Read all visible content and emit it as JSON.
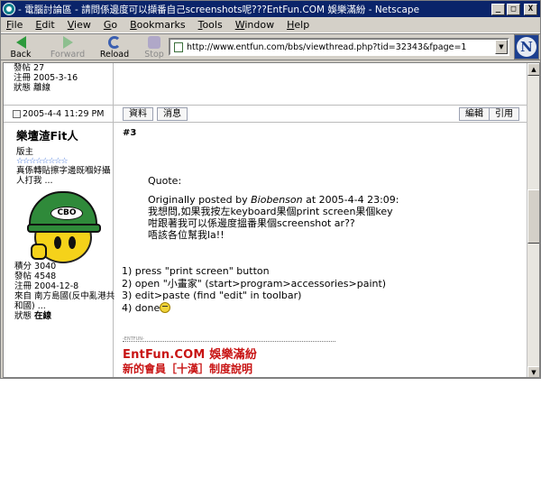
{
  "window": {
    "title": "- 電腦討論區 - 請問係邊度可以擷番自己screenshots呢???EntFun.COM 娛樂滿紛 - Netscape",
    "controls": [
      "_",
      "□",
      "X"
    ]
  },
  "menubar": {
    "items": [
      "File",
      "Edit",
      "View",
      "Go",
      "Bookmarks",
      "Tools",
      "Window",
      "Help"
    ]
  },
  "toolbar": {
    "back": "Back",
    "forward": "Forward",
    "reload": "Reload",
    "stop": "Stop",
    "url": "http://www.entfun.com/bbs/viewthread.php?tid=32343&fpage=1",
    "logo_letter": "N"
  },
  "previous_post": {
    "lines": [
      "發帖 27",
      "注冊 2005-3-16",
      "狀態 離線"
    ]
  },
  "post": {
    "date": "2005-4-4 11:29 PM",
    "buttons": {
      "profile": "資料",
      "message": "消息",
      "edit": "編輯",
      "quote": "引用"
    },
    "number": "#3",
    "author": {
      "name": "樂壇渣Fit人",
      "rank": "版主",
      "stars": "☆☆☆☆☆☆☆☆",
      "signature": "真係轉貼擦字邊既嗰好攝人打我 ...",
      "avatar_badge": "CBO",
      "stats": {
        "points": "積分 3040",
        "posts": "發帖 4548",
        "registered": "注冊 2004-12-8",
        "from": "來自 南方島國(反中亂港共和國) ...",
        "status_label": "狀態",
        "status_value": "在線"
      }
    },
    "quote": {
      "label": "Quote:",
      "header_prefix": "Originally posted by",
      "header_author": "Biobenson",
      "header_suffix": "at 2005-4-4 23:09:",
      "lines": [
        "我想問,如果我按左keyboard果個print screen果個key",
        "咁跟著我可以係邊度搵番果個screenshot ar??",
        "唔該各位幫我la!!"
      ]
    },
    "steps": [
      "1) press \"print screen\" button",
      "2) open \"小畫家\" (start>program>accessories>paint)",
      "3) edit>paste (find \"edit\" in toolbar)",
      "4) done"
    ],
    "signature_block": {
      "small": "-ENTFUN-",
      "site": "EntFun.COM 娛樂滿紛",
      "sub": "新的會員［十漢］制度說明"
    }
  }
}
